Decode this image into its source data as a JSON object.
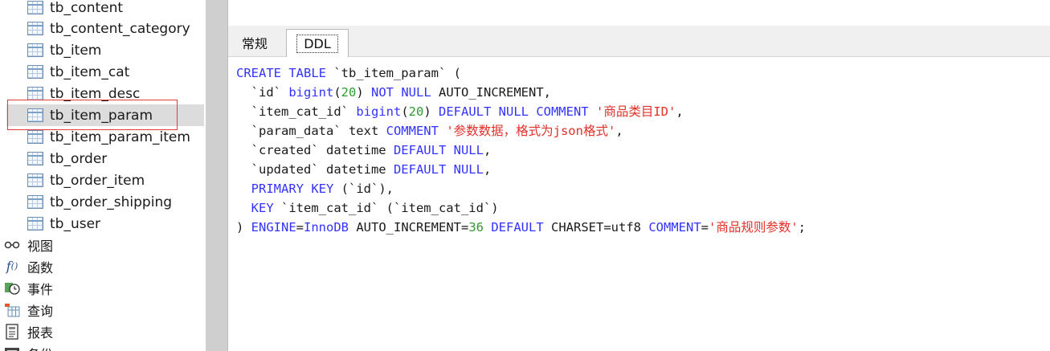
{
  "sidebar": {
    "tables": [
      {
        "name": "tb_content",
        "selected": false
      },
      {
        "name": "tb_content_category",
        "selected": false
      },
      {
        "name": "tb_item",
        "selected": false
      },
      {
        "name": "tb_item_cat",
        "selected": false
      },
      {
        "name": "tb_item_desc",
        "selected": false
      },
      {
        "name": "tb_item_param",
        "selected": true
      },
      {
        "name": "tb_item_param_item",
        "selected": false
      },
      {
        "name": "tb_order",
        "selected": false
      },
      {
        "name": "tb_order_item",
        "selected": false
      },
      {
        "name": "tb_order_shipping",
        "selected": false
      },
      {
        "name": "tb_user",
        "selected": false
      }
    ],
    "objects": [
      {
        "label": "视图",
        "icon": "glasses-icon"
      },
      {
        "label": "函数",
        "icon": "function-icon"
      },
      {
        "label": "事件",
        "icon": "event-clock-icon"
      },
      {
        "label": "查询",
        "icon": "query-icon"
      },
      {
        "label": "报表",
        "icon": "report-icon"
      },
      {
        "label": "备份",
        "icon": "backup-icon"
      }
    ]
  },
  "tabs": {
    "general": "常规",
    "ddl": "DDL",
    "active": "ddl"
  },
  "ddl": {
    "l1_kw": "CREATE TABLE",
    "l1_name": " `tb_item_param` (",
    "l2_col": "  `id` ",
    "l2_type": "bigint",
    "l2_p1": "(",
    "l2_num": "20",
    "l2_p2": ") ",
    "l2_kw": "NOT NULL",
    "l2_rest": " AUTO_INCREMENT,",
    "l3_col": "  `item_cat_id` ",
    "l3_type": "bigint",
    "l3_p1": "(",
    "l3_num": "20",
    "l3_p2": ") ",
    "l3_kw": "DEFAULT NULL COMMENT",
    "l3_sp": " ",
    "l3_str": "'商品类目ID'",
    "l3_end": ",",
    "l4_col": "  `param_data` text ",
    "l4_kw": "COMMENT",
    "l4_sp": " ",
    "l4_str": "'参数数据，格式为json格式'",
    "l4_end": ",",
    "l5_col": "  `created` datetime ",
    "l5_kw": "DEFAULT NULL",
    "l5_end": ",",
    "l6_col": "  `updated` datetime ",
    "l6_kw": "DEFAULT NULL",
    "l6_end": ",",
    "l7_kw": "  PRIMARY KEY",
    "l7_rest": " (`id`),",
    "l8_kw": "  KEY",
    "l8_rest": " `item_cat_id` (`item_cat_id`)",
    "l9_p": ") ",
    "l9_kw1": "ENGINE",
    "l9_eq1": "=",
    "l9_kw2": "InnoDB",
    "l9_ai": " AUTO_INCREMENT=",
    "l9_num": "36",
    "l9_sp1": " ",
    "l9_kw3": "DEFAULT",
    "l9_cs": " CHARSET=utf8 ",
    "l9_kw4": "COMMENT",
    "l9_eq2": "=",
    "l9_str": "'商品规则参数'",
    "l9_end": ";"
  },
  "colors": {
    "keyword": "#3333ff",
    "number": "#2e9a2e",
    "string": "#e0312a",
    "selection_outline": "#e33a3a"
  }
}
